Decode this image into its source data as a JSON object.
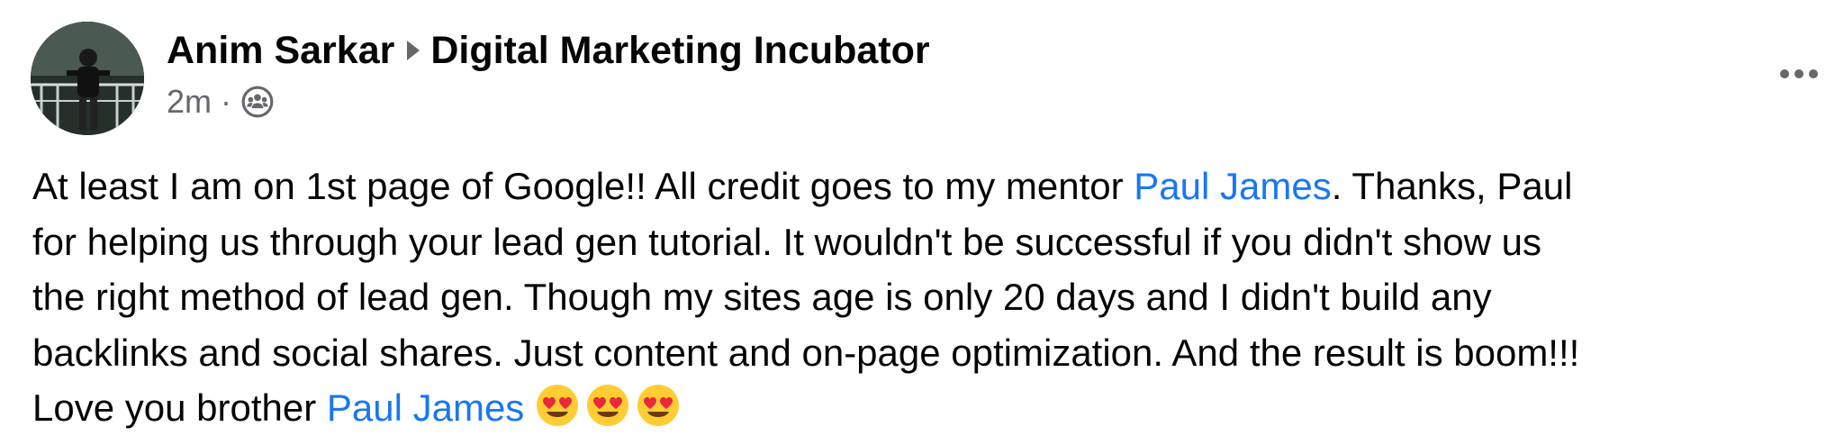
{
  "post": {
    "author": "Anim Sarkar",
    "group": "Digital Marketing Incubator",
    "time": "2m",
    "separator": "·",
    "audience_icon": "group-audience-icon",
    "more_icon": "more-options-icon",
    "body": {
      "line1_a": "At least I am on 1st page of Google!! All credit goes to my mentor ",
      "mention1": "Paul James",
      "line1_b": ". Thanks, Paul",
      "line2": "for helping us through your lead gen tutorial. It wouldn't be successful if you didn't show us",
      "line3": "the right method of lead gen. Though my sites age is only 20 days and I didn't build any",
      "line4": "backlinks and social shares. Just content and on-page optimization. And the result is boom!!!",
      "line5_a": "Love you brother ",
      "mention2": "Paul James",
      "emojis": [
        "heart-eyes-emoji",
        "heart-eyes-emoji",
        "heart-eyes-emoji"
      ]
    }
  }
}
